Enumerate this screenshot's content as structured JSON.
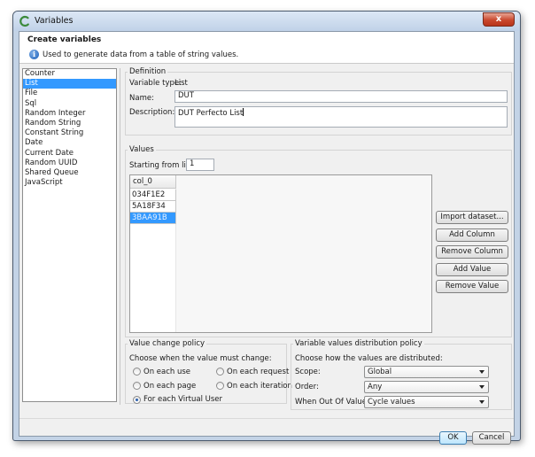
{
  "window": {
    "title": "Variables",
    "close_glyph": "x"
  },
  "header": {
    "title": "Create variables",
    "description": "Used to generate data from a table of string values.",
    "info_icon": "i"
  },
  "variable_types": {
    "items": [
      "Counter",
      "List",
      "File",
      "Sql",
      "Random Integer",
      "Random String",
      "Constant String",
      "Date",
      "Current Date",
      "Random UUID",
      "Shared Queue",
      "JavaScript"
    ],
    "selected": "List"
  },
  "definition": {
    "title": "Definition",
    "type_label": "Variable type:",
    "type_value": "List",
    "name_label": "Name:",
    "name_value": "DUT",
    "description_label": "Description:",
    "description_value": "DUT Perfecto List"
  },
  "values": {
    "title": "Values",
    "start_label": "Starting from line:",
    "start_value": "1",
    "column_header": "col_0",
    "rows": [
      "034F1E2",
      "5A18F34",
      "3BAA91B"
    ],
    "selected_row": "3BAA91B",
    "buttons": {
      "import": "Import dataset...",
      "add_column": "Add Column",
      "remove_column": "Remove Column",
      "add_value": "Add Value",
      "remove_value": "Remove Value"
    }
  },
  "change_policy": {
    "title": "Value change policy",
    "prompt": "Choose when the value must change:",
    "options": {
      "each_use": "On each use",
      "each_request": "On each request",
      "each_page": "On each page",
      "each_iteration": "On each iteration",
      "each_virtual_user": "For each Virtual User"
    },
    "selected": "For each Virtual User"
  },
  "distribution_policy": {
    "title": "Variable values distribution policy",
    "prompt": "Choose how the values are distributed:",
    "scope_label": "Scope:",
    "scope_value": "Global",
    "order_label": "Order:",
    "order_value": "Any",
    "out_label": "When Out Of Values:",
    "out_value": "Cycle values"
  },
  "footer": {
    "ok": "OK",
    "cancel": "Cancel"
  },
  "colors": {
    "selection": "#3399ff",
    "client_bg": "#f0f0f0",
    "close_button": "#c9482d"
  },
  "icons": {
    "app": "app-logo-icon",
    "info": "info-icon",
    "close": "close-icon",
    "dropdown": "chevron-down-icon"
  }
}
